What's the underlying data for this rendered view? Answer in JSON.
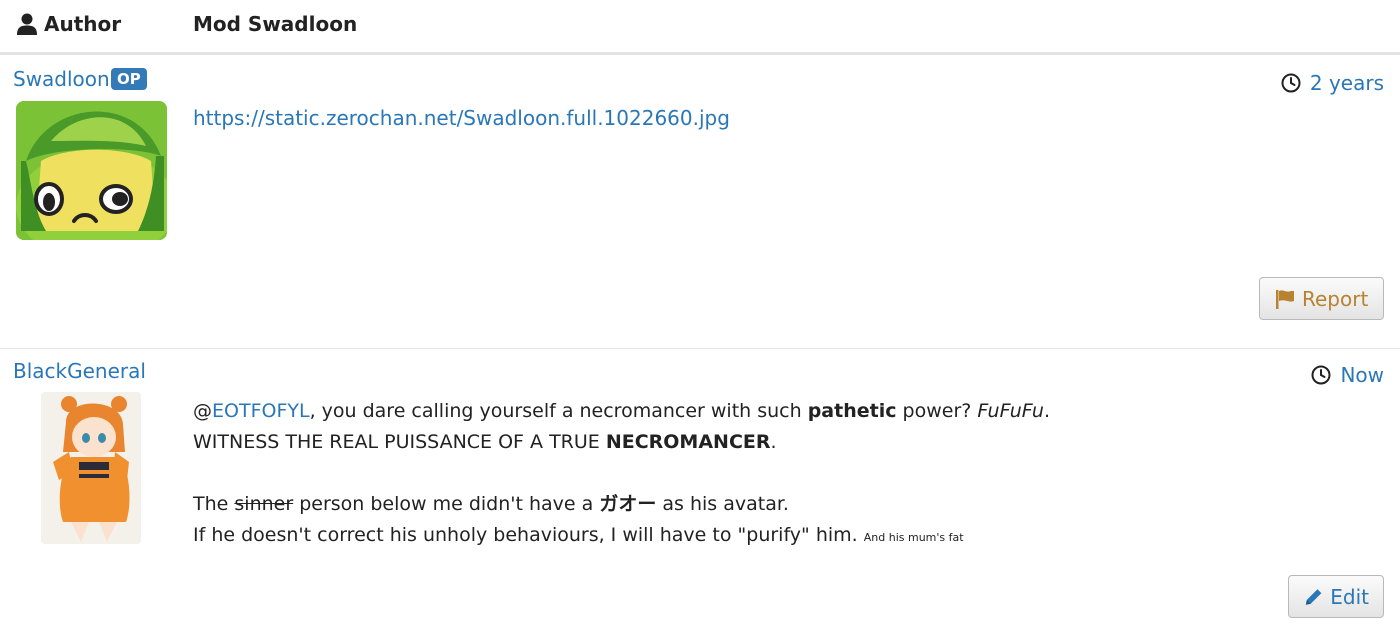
{
  "header": {
    "author_label": "Author",
    "topic_title": "Mod Swadloon"
  },
  "posts": [
    {
      "username": "Swadloon",
      "badge": "OP",
      "timestamp": "2 years",
      "link": "https://static.zerochan.net/Swadloon.full.1022660.jpg",
      "action_label": "Report",
      "avatar_icon": "swadloon-avatar"
    },
    {
      "username": "BlackGeneral",
      "timestamp": "Now",
      "mention_at": "@",
      "mention": "EOTFOFYL",
      "line1_a": ", you dare calling yourself a necromancer with such ",
      "line1_bold": "pathetic",
      "line1_b": " power? ",
      "line1_italic": "FuFuFu",
      "line1_end": ".",
      "line2_a": "WITNESS THE REAL PUISSANCE OF A TRUE ",
      "line2_bold": "NECROMANCER",
      "line2_end": ".",
      "line3_a": "The ",
      "line3_strike": "sinner",
      "line3_b": " person below me didn't have a ",
      "line3_bold": "ガオー",
      "line3_c": " as his avatar.",
      "line4": "If he doesn't correct his unholy behaviours, I will have to \"purify\" him.",
      "line4_small": "And his mum's fat",
      "action_label": "Edit",
      "avatar_icon": "anime-girl-avatar"
    }
  ],
  "colors": {
    "link": "#2a77b8",
    "badge": "#337ab7",
    "report": "#b78330"
  }
}
